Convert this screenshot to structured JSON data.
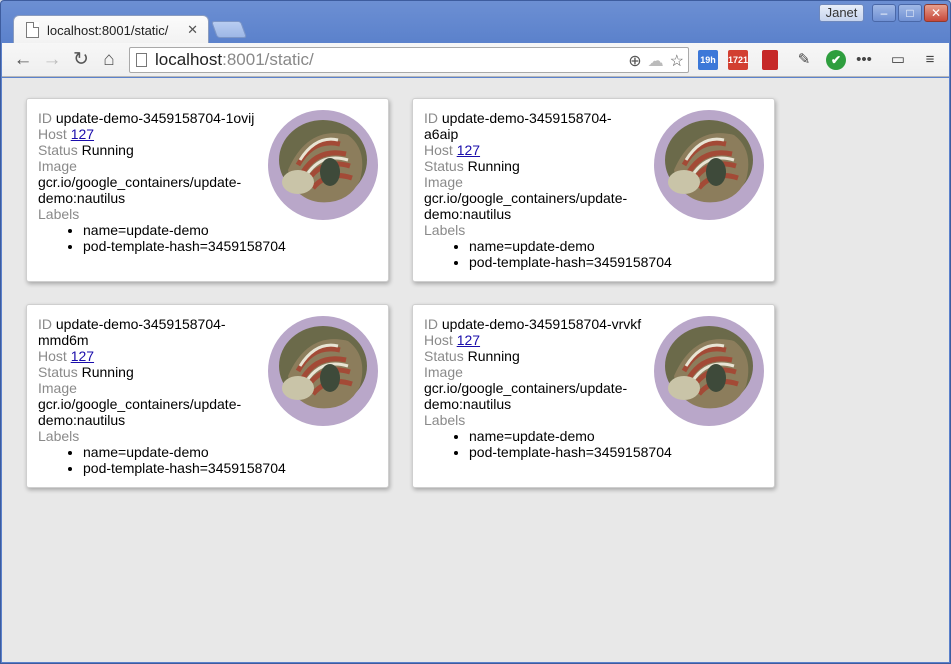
{
  "browser": {
    "tab_title": "localhost:8001/static/",
    "tab_close": "✕",
    "user_name": "Janet",
    "url_host": "localhost",
    "url_rest": ":8001/static/",
    "ext_calendar_badge": "19h",
    "ext_mail_badge": "1721"
  },
  "pods": [
    {
      "id_label": "ID",
      "id": "update-demo-3459158704-1ovij",
      "host_label": "Host",
      "host": "127",
      "status_label": "Status",
      "status": "Running",
      "image_label": "Image",
      "image": "gcr.io/google_containers/update-demo:nautilus",
      "labels_label": "Labels",
      "labels": [
        "name=update-demo",
        "pod-template-hash=3459158704"
      ]
    },
    {
      "id_label": "ID",
      "id": "update-demo-3459158704-a6aip",
      "host_label": "Host",
      "host": "127",
      "status_label": "Status",
      "status": "Running",
      "image_label": "Image",
      "image": "gcr.io/google_containers/update-demo:nautilus",
      "labels_label": "Labels",
      "labels": [
        "name=update-demo",
        "pod-template-hash=3459158704"
      ]
    },
    {
      "id_label": "ID",
      "id": "update-demo-3459158704-mmd6m",
      "host_label": "Host",
      "host": "127",
      "status_label": "Status",
      "status": "Running",
      "image_label": "Image",
      "image": "gcr.io/google_containers/update-demo:nautilus",
      "labels_label": "Labels",
      "labels": [
        "name=update-demo",
        "pod-template-hash=3459158704"
      ]
    },
    {
      "id_label": "ID",
      "id": "update-demo-3459158704-vrvkf",
      "host_label": "Host",
      "host": "127",
      "status_label": "Status",
      "status": "Running",
      "image_label": "Image",
      "image": "gcr.io/google_containers/update-demo:nautilus",
      "labels_label": "Labels",
      "labels": [
        "name=update-demo",
        "pod-template-hash=3459158704"
      ]
    }
  ]
}
